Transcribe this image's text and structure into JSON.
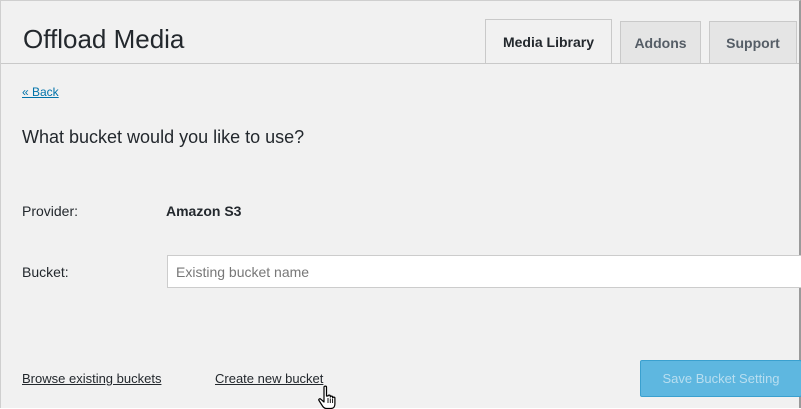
{
  "header": {
    "title": "Offload Media"
  },
  "tabs": [
    {
      "label": "Media Library",
      "active": true
    },
    {
      "label": "Addons",
      "active": false
    },
    {
      "label": "Support",
      "active": false
    }
  ],
  "nav": {
    "back_label": "« Back"
  },
  "form": {
    "question": "What bucket would you like to use?",
    "provider_label": "Provider:",
    "provider_value": "Amazon S3",
    "bucket_label": "Bucket:",
    "bucket_value": "",
    "bucket_placeholder": "Existing bucket name"
  },
  "footer": {
    "browse_label": "Browse existing buckets",
    "create_label": "Create new bucket",
    "save_label": "Save Bucket Setting"
  },
  "colors": {
    "link": "#0073aa",
    "button_bg": "#5eb7e0",
    "button_border": "#3aa0cf",
    "background": "#f1f1f1"
  },
  "icons": {
    "cursor": "hand-pointer-icon"
  }
}
